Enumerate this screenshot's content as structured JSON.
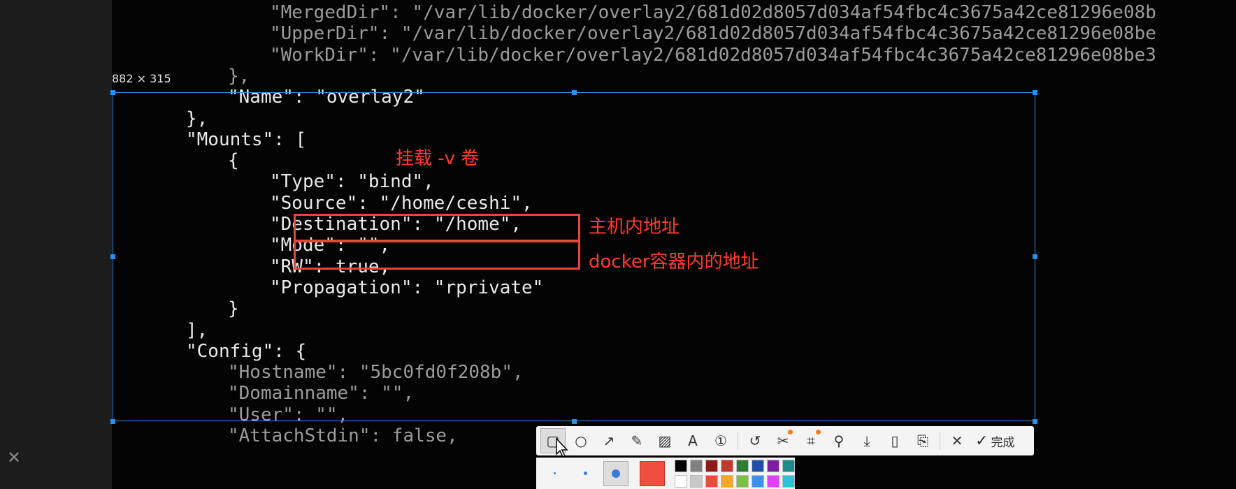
{
  "side_panel": {
    "close_glyph": "✕"
  },
  "terminal": {
    "lines": [
      {
        "text": "\"MergedDir\": \"/var/lib/docker/overlay2/681d02d8057d034af54fbc4c3675a42ce81296e08b",
        "indent": 3,
        "dim": true
      },
      {
        "text": "\"UpperDir\": \"/var/lib/docker/overlay2/681d02d8057d034af54fbc4c3675a42ce81296e08be",
        "indent": 3,
        "dim": true
      },
      {
        "text": "\"WorkDir\": \"/var/lib/docker/overlay2/681d02d8057d034af54fbc4c3675a42ce81296e08be3",
        "indent": 3,
        "dim": true
      },
      {
        "text": "},",
        "indent": 2,
        "dim": true
      },
      {
        "text": "\"Name\": \"overlay2\"",
        "indent": 2,
        "dim": false
      },
      {
        "text": "},",
        "indent": 1,
        "dim": false
      },
      {
        "text": "\"Mounts\": [",
        "indent": 1,
        "dim": false
      },
      {
        "text": "{",
        "indent": 2,
        "dim": false
      },
      {
        "text": "\"Type\": \"bind\",",
        "indent": 3,
        "dim": false
      },
      {
        "text": "\"Source\": \"/home/ceshi\",",
        "indent": 3,
        "dim": false
      },
      {
        "text": "\"Destination\": \"/home\",",
        "indent": 3,
        "dim": false
      },
      {
        "text": "\"Mode\": \"\",",
        "indent": 3,
        "dim": false
      },
      {
        "text": "\"RW\": true,",
        "indent": 3,
        "dim": false
      },
      {
        "text": "\"Propagation\": \"rprivate\"",
        "indent": 3,
        "dim": false
      },
      {
        "text": "}",
        "indent": 2,
        "dim": false
      },
      {
        "text": "],",
        "indent": 1,
        "dim": false
      },
      {
        "text": "\"Config\": {",
        "indent": 1,
        "dim": false
      },
      {
        "text": "\"Hostname\": \"5bc0fd0f208b\",",
        "indent": 2,
        "dim": true
      },
      {
        "text": "\"Domainname\": \"\",",
        "indent": 2,
        "dim": true
      },
      {
        "text": "\"User\": \"\",",
        "indent": 2,
        "dim": true
      },
      {
        "text": "\"AttachStdin\": false,",
        "indent": 2,
        "dim": true
      }
    ]
  },
  "selection": {
    "size_label": "882 × 315"
  },
  "annotations": {
    "mounts_note": "挂载 -v 卷",
    "source_note": "主机内地址",
    "destination_note": "docker容器内的地址"
  },
  "toolbar": {
    "tools": [
      {
        "name": "rectangle-tool",
        "glyph": "▢",
        "active": true,
        "badge": false
      },
      {
        "name": "ellipse-tool",
        "glyph": "○",
        "active": false,
        "badge": false
      },
      {
        "name": "arrow-tool",
        "glyph": "↗",
        "active": false,
        "badge": false
      },
      {
        "name": "pen-tool",
        "glyph": "✎",
        "active": false,
        "badge": false
      },
      {
        "name": "mosaic-tool",
        "glyph": "▨",
        "active": false,
        "badge": false
      },
      {
        "name": "text-tool",
        "glyph": "A",
        "active": false,
        "badge": false
      },
      {
        "name": "number-tool",
        "glyph": "①",
        "active": false,
        "badge": false
      },
      {
        "name": "undo-tool",
        "glyph": "↺",
        "active": false,
        "badge": false
      },
      {
        "name": "eraser-tool",
        "glyph": "✂",
        "active": false,
        "badge": true
      },
      {
        "name": "ocr-tool",
        "glyph": "⌗",
        "active": false,
        "badge": true
      },
      {
        "name": "pin-tool",
        "glyph": "⚲",
        "active": false,
        "badge": false
      },
      {
        "name": "download-tool",
        "glyph": "⤓",
        "active": false,
        "badge": false
      },
      {
        "name": "phone-tool",
        "glyph": "▯",
        "active": false,
        "badge": false
      },
      {
        "name": "bookmark-tool",
        "glyph": "⎘",
        "active": false,
        "badge": false
      },
      {
        "name": "cancel-tool",
        "glyph": "✕",
        "active": false,
        "badge": false
      }
    ],
    "done_label": "完成",
    "done_glyph": "✓"
  },
  "style_bar": {
    "current_color": "#f04e3e",
    "palette": [
      "#000000",
      "#808080",
      "#8b1a1a",
      "#c0392b",
      "#2e7d32",
      "#1f4fa8",
      "#7b1fa2",
      "#1e8a8a",
      "#ffffff",
      "#c8c8c8",
      "#e74c3c",
      "#f5a623",
      "#7cc242",
      "#3d8ff0",
      "#e040fb",
      "#26c6da"
    ]
  }
}
